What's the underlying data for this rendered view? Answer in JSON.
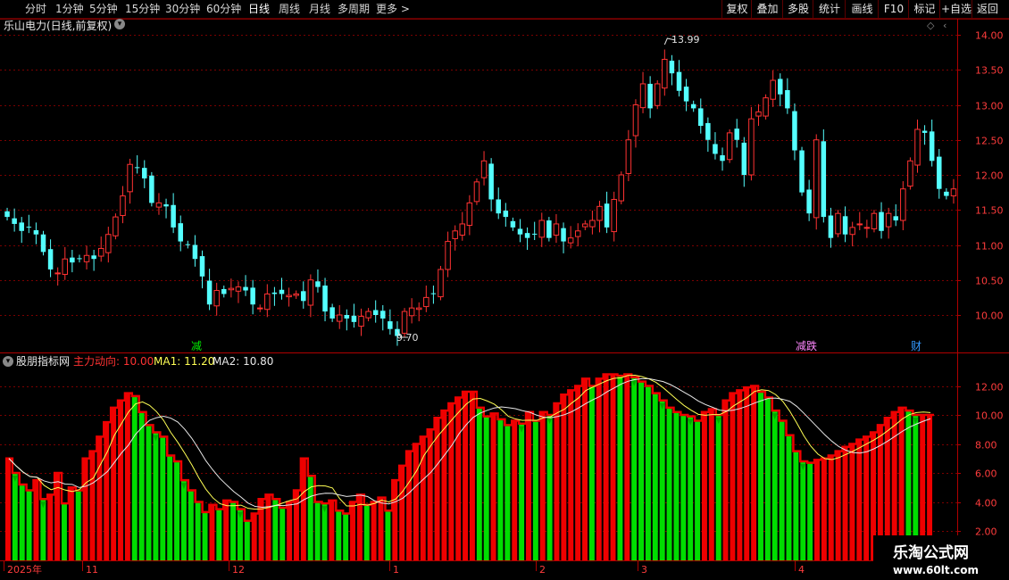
{
  "toolbar": {
    "periods": [
      "分时",
      "1分钟",
      "5分钟",
      "15分钟",
      "30分钟",
      "60分钟",
      "日线",
      "周线",
      "月线",
      "多周期",
      "更多 >"
    ],
    "active_period": "日线",
    "right_buttons": [
      "复权",
      "叠加",
      "多股",
      "统计",
      "画线",
      "F10",
      "标记",
      "+自选",
      "返回"
    ]
  },
  "main_panel": {
    "title": "乐山电力(日线,前复权)",
    "high_label": "13.99",
    "low_label": "9.70",
    "price_axis": [
      "14.00",
      "13.50",
      "13.00",
      "12.50",
      "12.00",
      "11.50",
      "11.00",
      "10.50",
      "10.00"
    ],
    "markers": [
      "减",
      "减跌",
      "财"
    ]
  },
  "indicator_panel": {
    "name": "股朋指标网",
    "main_label": "主力动向:",
    "main_value": "10.00",
    "ma1_label": "MA1:",
    "ma1_value": "11.20",
    "ma2_label": "MA2:",
    "ma2_value": "10.80",
    "axis": [
      "12.00",
      "10.00",
      "8.00",
      "6.00",
      "4.00",
      "2.00"
    ]
  },
  "time_axis": [
    "2025年",
    "11",
    "12",
    "1",
    "2",
    "3",
    "4"
  ],
  "watermark": {
    "line1": "乐淘公式网",
    "line2": "www.60lt.com"
  },
  "colors": {
    "up": "#ff3232",
    "down": "#54ffff",
    "bar_green": "#00dd00",
    "bar_red": "#ee0000",
    "ma1": "#ffff55",
    "ma2": "#e8e8e8",
    "grid": "#7a0000",
    "axis_text": "#ff3c3c"
  },
  "chart_data": {
    "type": "candlestick",
    "price_range": [
      9.55,
      14.2
    ],
    "indicator_range": [
      1.5,
      13.2
    ],
    "closes": [
      11.4,
      11.3,
      11.2,
      11.25,
      11.15,
      10.9,
      10.65,
      10.6,
      10.8,
      10.75,
      10.8,
      10.85,
      10.8,
      10.95,
      11.15,
      11.4,
      11.7,
      12.15,
      12.1,
      11.95,
      11.6,
      11.6,
      11.55,
      11.25,
      11.05,
      11.0,
      10.8,
      10.55,
      10.15,
      10.35,
      10.3,
      10.38,
      10.4,
      10.35,
      10.15,
      10.1,
      10.3,
      10.3,
      10.3,
      10.28,
      10.3,
      10.2,
      10.5,
      10.4,
      10.05,
      9.95,
      10.0,
      9.95,
      9.9,
      9.98,
      10.05,
      10.0,
      9.95,
      9.8,
      9.7,
      10.05,
      10.1,
      10.1,
      10.25,
      10.3,
      10.65,
      11.05,
      11.2,
      11.3,
      11.6,
      11.9,
      12.2,
      11.65,
      11.45,
      11.4,
      11.25,
      11.15,
      11.1,
      11.15,
      11.35,
      11.1,
      11.3,
      11.05,
      11.1,
      11.2,
      11.3,
      11.35,
      11.55,
      11.25,
      11.65,
      12.0,
      12.5,
      13.0,
      13.3,
      12.95,
      13.3,
      13.65,
      13.45,
      13.2,
      13.05,
      12.95,
      12.7,
      12.5,
      12.3,
      12.2,
      12.6,
      12.5,
      12.0,
      12.8,
      12.9,
      13.1,
      13.35,
      13.15,
      12.95,
      12.35,
      11.75,
      11.45,
      12.5,
      11.4,
      11.1,
      11.45,
      11.15,
      11.25,
      11.3,
      11.25,
      11.45,
      11.2,
      11.45,
      11.35,
      11.8,
      12.2,
      12.65,
      12.6,
      12.2,
      11.8,
      11.7,
      11.8
    ],
    "indicator": [
      7,
      6,
      5.2,
      4.8,
      5.5,
      4.2,
      4.5,
      6.0,
      3.9,
      5.0,
      4.8,
      7.0,
      7.5,
      8.5,
      9.5,
      10.5,
      11.0,
      11.5,
      11.3,
      10.2,
      9.3,
      8.8,
      8.5,
      7.2,
      6.8,
      5.5,
      4.8,
      4.0,
      3.3,
      3.8,
      3.5,
      4.1,
      4.0,
      3.5,
      2.7,
      3.2,
      4.2,
      4.5,
      4.2,
      3.6,
      4.0,
      4.8,
      7.0,
      5.8,
      4.0,
      3.9,
      4.1,
      3.4,
      3.2,
      4.0,
      4.5,
      3.8,
      4.0,
      4.3,
      3.4,
      5.5,
      6.5,
      7.5,
      8.0,
      8.5,
      9.0,
      9.8,
      10.3,
      10.8,
      11.2,
      11.6,
      11.6,
      10.5,
      9.9,
      10.1,
      9.7,
      9.3,
      9.6,
      9.4,
      10.2,
      9.6,
      10.2,
      10.0,
      10.8,
      11.4,
      11.7,
      12.0,
      12.5,
      12.0,
      12.5,
      12.8,
      12.8,
      12.7,
      12.8,
      12.6,
      12.3,
      12.0,
      11.5,
      11.0,
      10.5,
      10.2,
      10.0,
      9.9,
      9.6,
      10.2,
      10.4,
      10.0,
      11.0,
      11.5,
      11.7,
      11.9,
      12.0,
      11.6,
      11.2,
      10.3,
      9.6,
      8.6,
      7.5,
      6.8,
      6.7,
      6.9,
      7.0,
      7.2,
      7.5,
      7.8,
      8.0,
      8.3,
      8.5,
      8.8,
      9.3,
      9.8,
      10.2,
      10.5,
      10.3,
      10.0,
      10.0,
      10.0
    ]
  }
}
